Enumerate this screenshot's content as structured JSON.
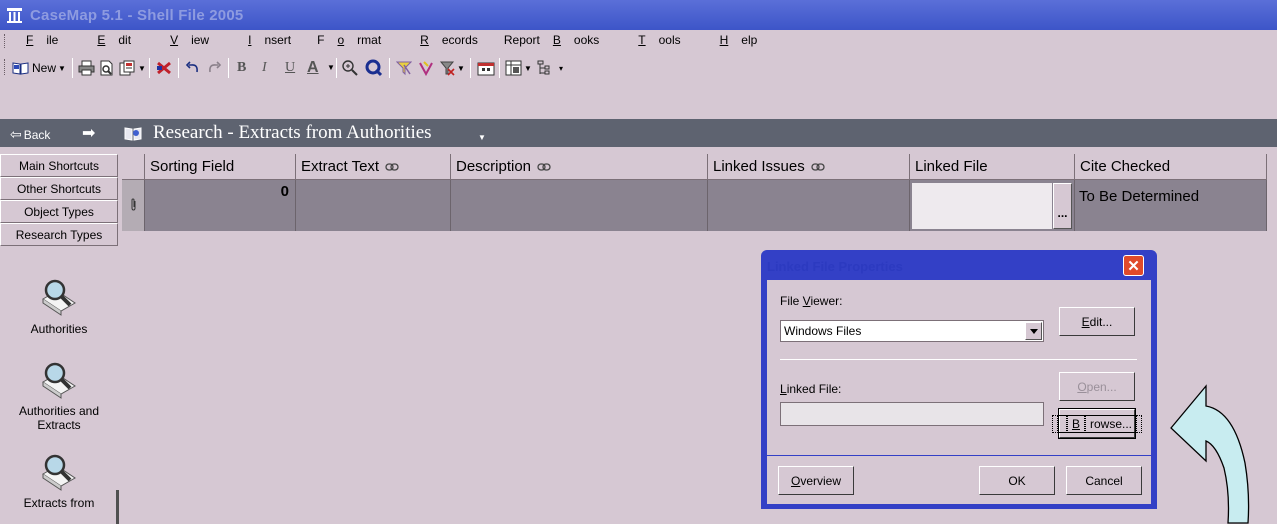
{
  "window": {
    "title": "CaseMap 5.1 - Shell File 2005"
  },
  "menu": [
    {
      "pre": "",
      "key": "F",
      "post": "ile"
    },
    {
      "pre": "",
      "key": "E",
      "post": "dit"
    },
    {
      "pre": "",
      "key": "V",
      "post": "iew"
    },
    {
      "pre": "",
      "key": "I",
      "post": "nsert"
    },
    {
      "pre": "F",
      "key": "o",
      "post": "rmat"
    },
    {
      "pre": "",
      "key": "R",
      "post": "ecords"
    },
    {
      "pre": "Report",
      "key": "B",
      "post": "ooks"
    },
    {
      "pre": "",
      "key": "T",
      "post": "ools"
    },
    {
      "pre": "",
      "key": "H",
      "post": "elp"
    }
  ],
  "toolbar": {
    "new_label": "New",
    "bold": "B",
    "italic": "I",
    "underline": "U",
    "font_color": "A"
  },
  "nav": {
    "back_label": "Back",
    "title": "Research - Extracts from Authorities",
    "icons": {
      "back": "back-arrow-icon",
      "forward": "forward-arrow-icon",
      "research": "book-magnifier-icon"
    }
  },
  "sidebar": {
    "buttons": [
      "Main Shortcuts",
      "Other Shortcuts",
      "Object Types",
      "Research Types"
    ],
    "items": [
      {
        "lines": [
          "Authorities"
        ],
        "icon": "magnifier-icon"
      },
      {
        "lines": [
          "Authorities and",
          "Extracts"
        ],
        "icon": "magnifier-icon"
      },
      {
        "lines": [
          "Extracts from"
        ],
        "icon": "magnifier-icon"
      }
    ]
  },
  "grid": {
    "columns": [
      {
        "label": "Sorting Field",
        "linked": false
      },
      {
        "label": "Extract Text",
        "linked": true
      },
      {
        "label": "Description",
        "linked": true
      },
      {
        "label": "Linked Issues",
        "linked": true
      },
      {
        "label": "Linked File",
        "linked": false
      },
      {
        "label": "Cite Checked",
        "linked": false
      }
    ],
    "row": {
      "sorting_field": "0",
      "extract_text": "",
      "description": "",
      "linked_issues": "",
      "linked_file": "",
      "linked_file_button": "...",
      "cite_checked": "To Be Determined"
    }
  },
  "dialog": {
    "title": "Linked File Properties",
    "close_glyph": "✕",
    "file_viewer_label": {
      "pre": "File ",
      "key": "V",
      "post": "iewer:"
    },
    "file_viewer_value": "Windows Files",
    "edit_button": {
      "pre": "",
      "key": "E",
      "post": "dit..."
    },
    "linked_file_label": {
      "pre": "",
      "key": "L",
      "post": "inked File:"
    },
    "linked_file_value": "",
    "open_button": {
      "pre": "",
      "key": "O",
      "post": "pen..."
    },
    "browse_button": {
      "pre": "",
      "key": "B",
      "post": "rowse..."
    },
    "overview_button": {
      "pre": "",
      "key": "O",
      "post": "verview"
    },
    "ok_button": "OK",
    "cancel_button": "Cancel"
  },
  "colors": {
    "titlebar": "#4a62d2",
    "window_bg": "#d6c8d3",
    "navbar": "#5e6370",
    "grid_row": "#8a8390",
    "dialog_frame": "#3340c6",
    "close_button": "#e04a2a",
    "arrow_fill": "#c8ecf0"
  }
}
